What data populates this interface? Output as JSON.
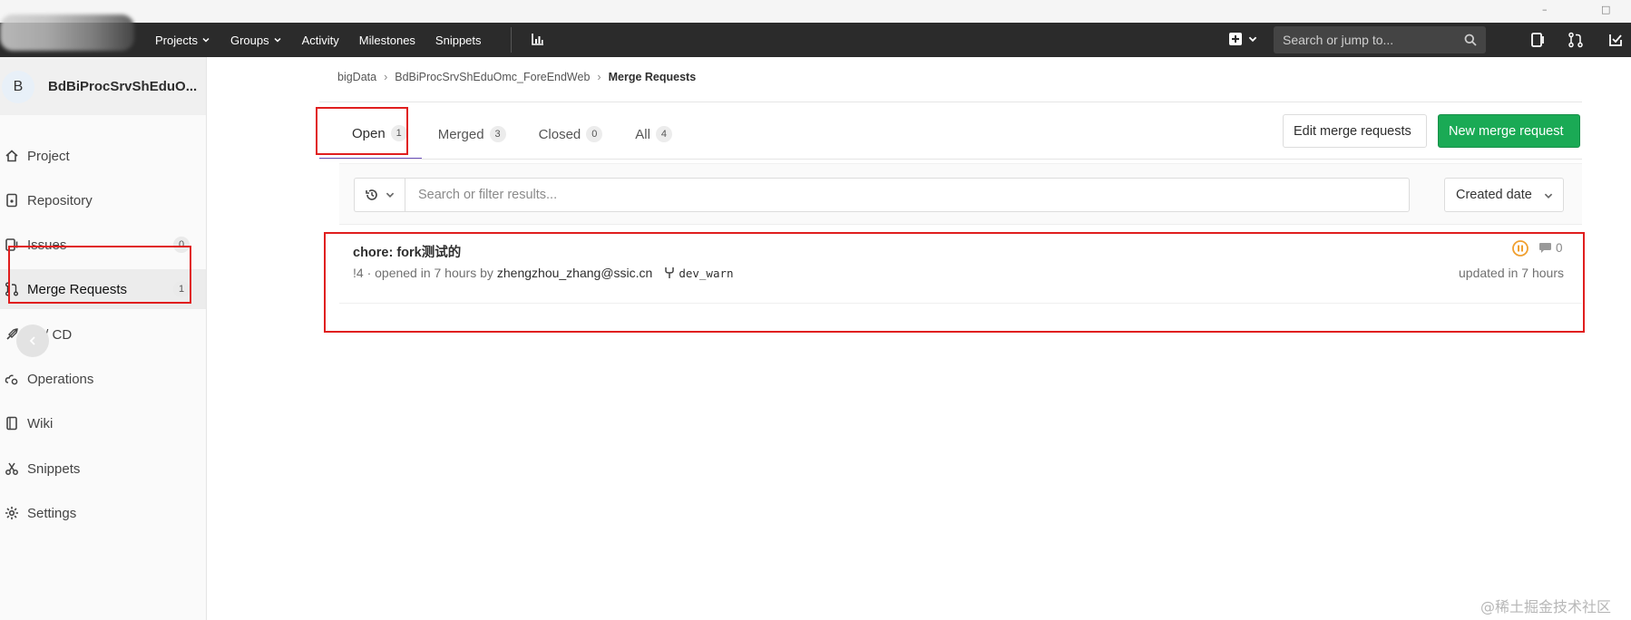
{
  "window": {
    "minimize": "–",
    "maximize": "□"
  },
  "topnav": {
    "links": [
      "Projects",
      "Groups",
      "Activity",
      "Milestones",
      "Snippets"
    ],
    "search_placeholder": "Search or jump to..."
  },
  "sidebar": {
    "project_avatar": "B",
    "project_name": "BdBiProcSrvShEduO...",
    "items": [
      {
        "label": "Project",
        "icon": "home-icon"
      },
      {
        "label": "Repository",
        "icon": "doc-icon"
      },
      {
        "label": "Issues",
        "icon": "issues-icon",
        "count": "0"
      },
      {
        "label": "Merge Requests",
        "icon": "merge-request-icon",
        "count": "1"
      },
      {
        "label": "CI / CD",
        "icon": "rocket-icon"
      },
      {
        "label": "Operations",
        "icon": "cloud-gear-icon"
      },
      {
        "label": "Wiki",
        "icon": "book-icon"
      },
      {
        "label": "Snippets",
        "icon": "scissors-icon"
      },
      {
        "label": "Settings",
        "icon": "gear-icon"
      }
    ]
  },
  "breadcrumb": {
    "group": "bigData",
    "project": "BdBiProcSrvShEduOmc_ForeEndWeb",
    "current": "Merge Requests"
  },
  "tabs": [
    {
      "label": "Open",
      "count": "1"
    },
    {
      "label": "Merged",
      "count": "3"
    },
    {
      "label": "Closed",
      "count": "0"
    },
    {
      "label": "All",
      "count": "4"
    }
  ],
  "buttons": {
    "edit": "Edit merge requests",
    "new": "New merge request"
  },
  "filter": {
    "placeholder": "Search or filter results...",
    "sort": "Created date"
  },
  "merge_requests": [
    {
      "title": "chore: fork测试的",
      "meta_prefix": "!4 · opened in 7 hours by",
      "author": "zhengzhou_zhang@ssic.cn",
      "branch": "dev_warn",
      "comments": "0",
      "updated": "updated in 7 hours"
    }
  ],
  "watermark": "@稀土掘金技术社区",
  "colors": {
    "accent_green": "#1aaa55",
    "annotation_red": "#e01e1e",
    "nav_dark": "#2b2b2b"
  }
}
